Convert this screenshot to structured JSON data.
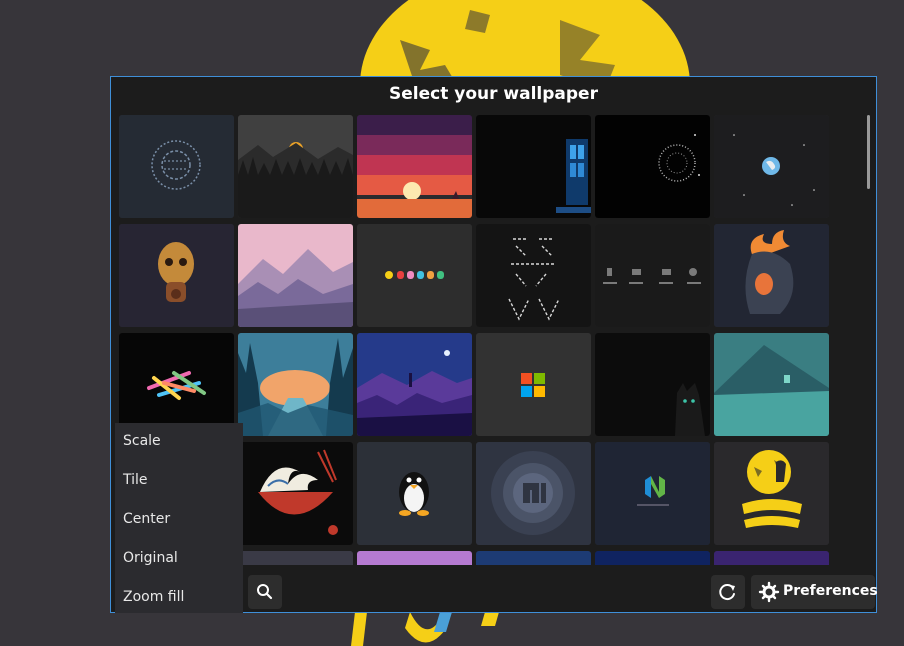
{
  "dialog": {
    "title": "Select your wallpaper"
  },
  "wallpapers": [
    {
      "name": "circular-glyph-art",
      "bg": "#252b34"
    },
    {
      "name": "dark-forest-sunset",
      "bg": "#3a3a3a"
    },
    {
      "name": "red-sunset-sea",
      "bg": "#b8344f"
    },
    {
      "name": "phone-booth-night",
      "bg": "#080808"
    },
    {
      "name": "dotted-planet",
      "bg": "#020202"
    },
    {
      "name": "tiny-earth-space",
      "bg": "#1d1d1f"
    },
    {
      "name": "skull-gas-mask",
      "bg": "#272533"
    },
    {
      "name": "pink-mountains",
      "bg": "#e6b7c8"
    },
    {
      "name": "pacman-ghosts",
      "bg": "#2d2d2d"
    },
    {
      "name": "line-art-figures",
      "bg": "#141414"
    },
    {
      "name": "minimal-icons",
      "bg": "#1a1a1a"
    },
    {
      "name": "flaming-skull-hood",
      "bg": "#222633"
    },
    {
      "name": "colorful-sticks",
      "bg": "#060606"
    },
    {
      "name": "forest-river-sunrise",
      "bg": "#2f6f8c"
    },
    {
      "name": "purple-mountain-night",
      "bg": "#273c8e"
    },
    {
      "name": "windows-logo",
      "bg": "#323232"
    },
    {
      "name": "black-cat-dark",
      "bg": "#0c0c0c"
    },
    {
      "name": "teal-mountain",
      "bg": "#3c7a7e"
    },
    {
      "name": "hidden-under-menu",
      "bg": "#2a2a2a"
    },
    {
      "name": "great-wave-ramen",
      "bg": "#0b0b0b"
    },
    {
      "name": "linux-tux",
      "bg": "#2c3038"
    },
    {
      "name": "manjaro-circle",
      "bg": "#2f3441"
    },
    {
      "name": "neovim-logo",
      "bg": "#1f2534"
    },
    {
      "name": "yellow-moon-poster",
      "bg": "#2a292c"
    },
    {
      "name": "row5-1",
      "bg": "#2a2a2a"
    },
    {
      "name": "row5-2",
      "bg": "#3a3a46"
    },
    {
      "name": "row5-3",
      "bg": "#b57ad1"
    },
    {
      "name": "row5-4",
      "bg": "#1d3b74"
    },
    {
      "name": "row5-5",
      "bg": "#0f2360"
    },
    {
      "name": "row5-6",
      "bg": "#3a2470"
    }
  ],
  "mode_menu": {
    "items": [
      "Scale",
      "Tile",
      "Center",
      "Original",
      "Zoom fill"
    ]
  },
  "bottom_bar": {
    "search_icon": "search-icon",
    "refresh_icon": "refresh-icon",
    "preferences_icon": "gear-icon",
    "preferences_label": "Preferences"
  },
  "colors": {
    "accent_border": "#3f8fd8",
    "dialog_bg": "#1c1c1c",
    "desktop_bg": "#37353a",
    "poster_yellow": "#f5cf17"
  }
}
